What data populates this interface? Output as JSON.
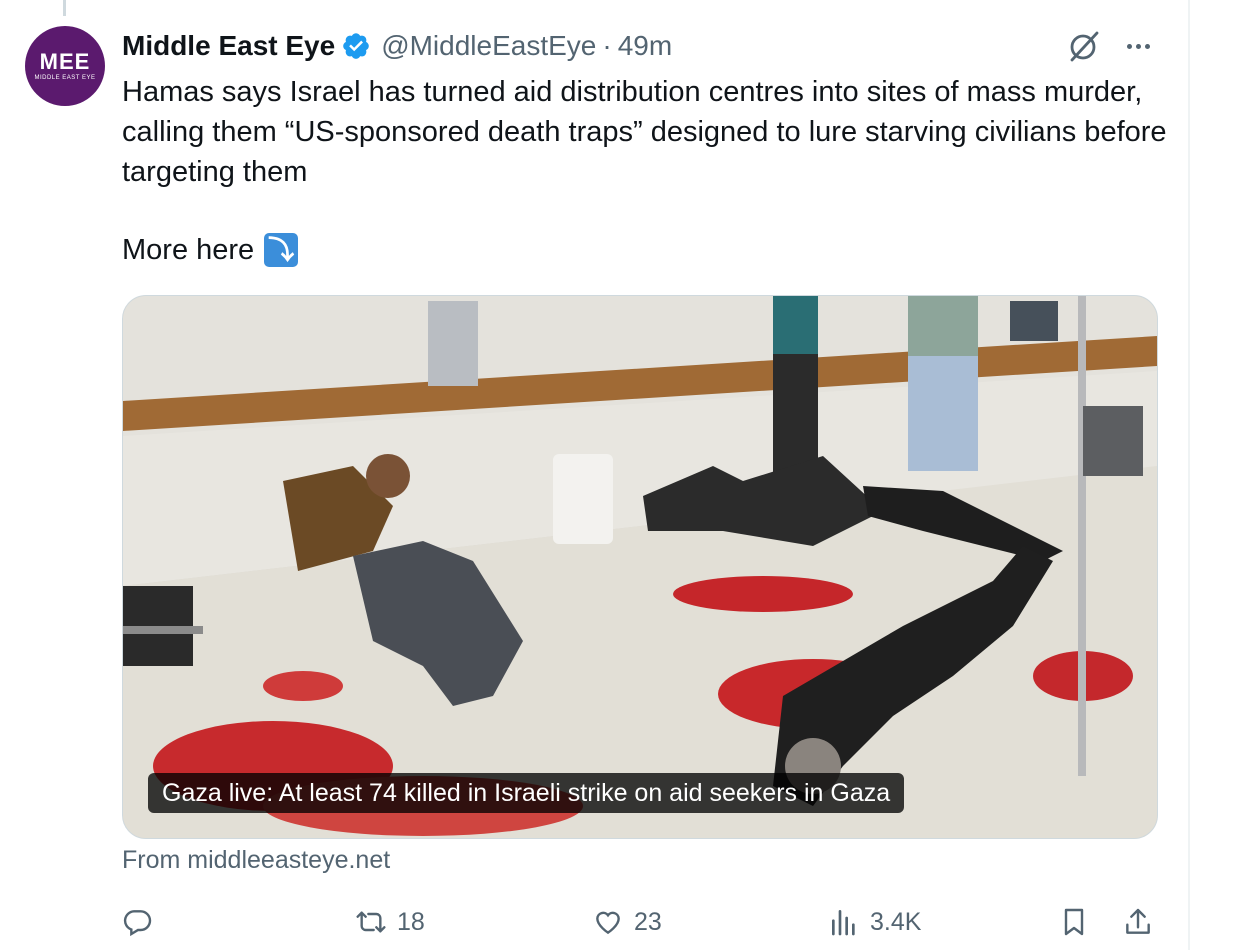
{
  "tweet": {
    "author_name": "Middle East Eye",
    "handle": "@MiddleEastEye",
    "separator": "·",
    "time": "49m",
    "avatar_logo": "MEE",
    "avatar_sub": "MIDDLE EAST EYE",
    "text": "Hamas says Israel has turned aid distribution centres into sites of mass murder, calling them “US-sponsored death traps” designed to lure starving civilians before targeting them",
    "more_here": "More here",
    "more_here_emoji": "⤵",
    "card": {
      "caption": "Gaza live: At least 74 killed in Israeli strike on aid seekers in Gaza",
      "source": "From middleeasteye.net"
    },
    "actions": {
      "replies": "",
      "reposts": "18",
      "likes": "23",
      "views": "3.4K"
    }
  },
  "icons": [
    "verified-badge-icon",
    "grok-icon",
    "more-icon",
    "reply-icon",
    "repost-icon",
    "like-icon",
    "views-icon",
    "bookmark-icon",
    "share-icon"
  ],
  "colors": {
    "verified": "#1d9bf0",
    "avatar_bg": "#5b1a6e",
    "muted": "#536471",
    "emoji_bg": "#3b8eda"
  }
}
